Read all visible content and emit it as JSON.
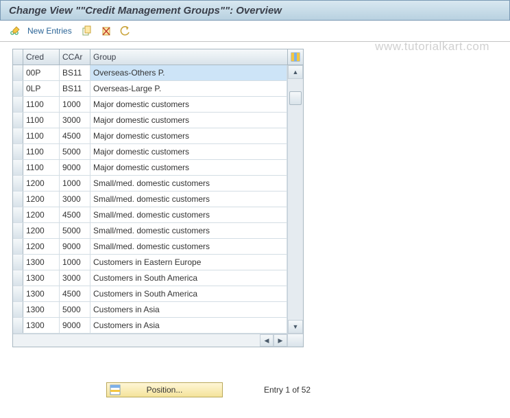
{
  "title": "Change View \"\"Credit Management Groups\"\": Overview",
  "toolbar": {
    "new_entries_label": "New Entries"
  },
  "table": {
    "headers": {
      "cred": "Cred",
      "ccar": "CCAr",
      "group": "Group"
    },
    "rows": [
      {
        "cred": "00P",
        "ccar": "BS11",
        "group": "Overseas-Others P.",
        "selected": true
      },
      {
        "cred": "0LP",
        "ccar": "BS11",
        "group": "Overseas-Large P."
      },
      {
        "cred": "1100",
        "ccar": "1000",
        "group": "Major domestic customers"
      },
      {
        "cred": "1100",
        "ccar": "3000",
        "group": "Major domestic customers"
      },
      {
        "cred": "1100",
        "ccar": "4500",
        "group": "Major domestic customers"
      },
      {
        "cred": "1100",
        "ccar": "5000",
        "group": "Major domestic customers"
      },
      {
        "cred": "1100",
        "ccar": "9000",
        "group": "Major domestic customers"
      },
      {
        "cred": "1200",
        "ccar": "1000",
        "group": "Small/med. domestic customers"
      },
      {
        "cred": "1200",
        "ccar": "3000",
        "group": "Small/med. domestic customers"
      },
      {
        "cred": "1200",
        "ccar": "4500",
        "group": "Small/med. domestic customers"
      },
      {
        "cred": "1200",
        "ccar": "5000",
        "group": "Small/med. domestic customers"
      },
      {
        "cred": "1200",
        "ccar": "9000",
        "group": "Small/med. domestic customers"
      },
      {
        "cred": "1300",
        "ccar": "1000",
        "group": "Customers in Eastern Europe"
      },
      {
        "cred": "1300",
        "ccar": "3000",
        "group": "Customers in South America"
      },
      {
        "cred": "1300",
        "ccar": "4500",
        "group": "Customers in South America"
      },
      {
        "cred": "1300",
        "ccar": "5000",
        "group": "Customers in Asia"
      },
      {
        "cred": "1300",
        "ccar": "9000",
        "group": "Customers in Asia"
      }
    ]
  },
  "footer": {
    "position_label": "Position...",
    "entry_text": "Entry 1 of 52"
  },
  "watermark": "www.tutorialkart.com"
}
